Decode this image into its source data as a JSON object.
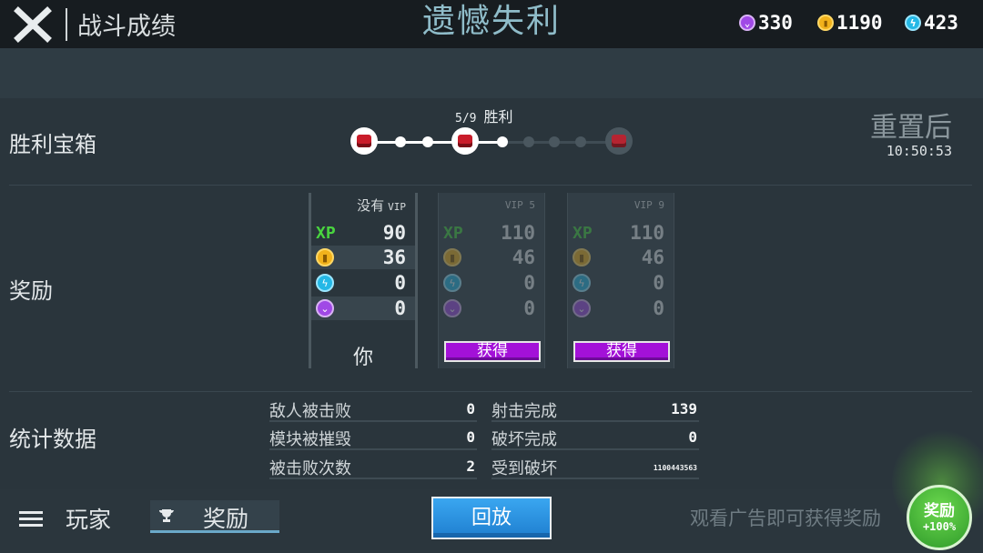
{
  "header": {
    "title": "战斗成绩",
    "result": "遗憾失利",
    "currencies": [
      {
        "name": "gem",
        "value": "330",
        "color": "#a049e6"
      },
      {
        "name": "coin",
        "value": "1190",
        "color": "#f2b21b"
      },
      {
        "name": "energy",
        "value": "423",
        "color": "#24b8e6"
      }
    ]
  },
  "chests": {
    "label": "胜利宝箱",
    "progress": "5/9",
    "progress_label": "胜利",
    "wins": 5,
    "total": 9,
    "reset_label": "重置后",
    "reset_time": "10:50:53"
  },
  "rewards": {
    "label": "奖励",
    "columns": [
      {
        "tier_label": "没有",
        "tier_tag": "VIP",
        "xp": "90",
        "coins": "36",
        "energy": "0",
        "gems": "0",
        "footer": "你"
      },
      {
        "tier_label": "",
        "tier_tag": "VIP 5",
        "xp": "110",
        "coins": "46",
        "energy": "0",
        "gems": "0",
        "footer": "获得"
      },
      {
        "tier_label": "",
        "tier_tag": "VIP 9",
        "xp": "110",
        "coins": "46",
        "energy": "0",
        "gems": "0",
        "footer": "获得"
      }
    ],
    "xp_icon": "XP"
  },
  "stats": {
    "label": "统计数据",
    "left": [
      {
        "label": "敌人被击败",
        "value": "0"
      },
      {
        "label": "模块被摧毁",
        "value": "0"
      },
      {
        "label": "被击败次数",
        "value": "2"
      }
    ],
    "right": [
      {
        "label": "射击完成",
        "value": "139"
      },
      {
        "label": "破坏完成",
        "value": "0"
      },
      {
        "label": "受到破坏",
        "value": "1100443563"
      }
    ]
  },
  "bottom": {
    "players_tab": "玩家",
    "rewards_tab": "奖励",
    "replay": "回放",
    "ad_text": "观看广告即可获得奖励",
    "ad_button_label": "奖励",
    "ad_button_bonus": "+100%"
  }
}
